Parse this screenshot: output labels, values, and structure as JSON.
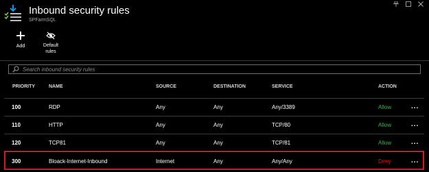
{
  "header": {
    "title": "Inbound security rules",
    "subtitle": "SPFarmSQL",
    "icon": "download-list-icon"
  },
  "window": {
    "buttons": [
      "pin-icon",
      "maximize-icon",
      "close-icon"
    ]
  },
  "toolbar": {
    "add_label": "Add",
    "default_rules_label_line1": "Default",
    "default_rules_label_line2": "rules",
    "icons": {
      "add": "plus-icon",
      "default_rules": "eye-slash-icon"
    }
  },
  "search": {
    "placeholder": "Search inbound security rules",
    "value": ""
  },
  "table": {
    "columns": {
      "priority": "PRIORITY",
      "name": "NAME",
      "source": "SOURCE",
      "destination": "DESTINATION",
      "service": "SERVICE",
      "action": "ACTION"
    },
    "rows": [
      {
        "priority": "100",
        "name": "RDP",
        "source": "Any",
        "destination": "Any",
        "service": "Any/3389",
        "action": "Allow",
        "more": "..."
      },
      {
        "priority": "110",
        "name": "HTTP",
        "source": "Any",
        "destination": "Any",
        "service": "TCP/80",
        "action": "Allow",
        "more": "..."
      },
      {
        "priority": "120",
        "name": "TCP81",
        "source": "Any",
        "destination": "Any",
        "service": "TCP/81",
        "action": "Allow",
        "more": "..."
      },
      {
        "priority": "300",
        "name": "Bloack-Internet-Inbound",
        "source": "Internet",
        "destination": "Any",
        "service": "Any/Any",
        "action": "Deny",
        "more": "..."
      }
    ],
    "highlighted_row": 3
  },
  "colors": {
    "background": "#000000",
    "allow": "#39b54a",
    "deny": "#e0141e",
    "highlight_border": "#e0141e",
    "accent": "#1f8fe0",
    "divider": "#3a3a3a"
  }
}
